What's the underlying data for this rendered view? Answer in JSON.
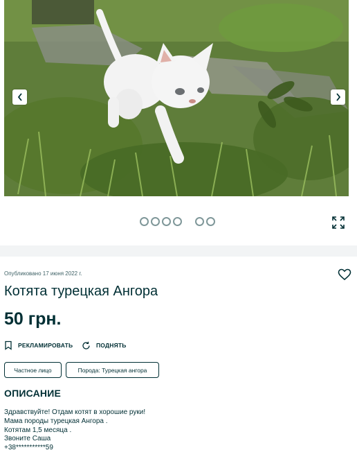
{
  "gallery": {
    "prev_icon": "chevron-left-icon",
    "next_icon": "chevron-right-icon",
    "fullscreen_icon": "expand-icon",
    "dot_count": 6,
    "active_dot": 0,
    "photo_subject": "white kitten walking on grass"
  },
  "ad": {
    "published": "Опубликовано 17 июня 2022 г.",
    "title": "Котята турецкая Ангора",
    "price": "50 грн.",
    "favorite_icon": "heart-icon"
  },
  "actions": {
    "promote_label": "РЕКЛАМИРОВАТЬ",
    "promote_icon": "bookmark-icon",
    "refresh_label": "ПОДНЯТЬ",
    "refresh_icon": "refresh-icon"
  },
  "tags": [
    "Частное лицо",
    "Порода: Турецкая ангора"
  ],
  "description": {
    "heading": "ОПИСАНИЕ",
    "lines": [
      "Здравствуйте! Отдам котят в хорошие руки!",
      "Мама породы турецкая Ангора .",
      "Котятам 1,5 месяца .",
      "Звоните Саша",
      "+38***********59"
    ]
  },
  "colors": {
    "text": "#002f34",
    "muted": "#406367",
    "divider": "#f2f4f5",
    "dot": "#7f9799"
  }
}
